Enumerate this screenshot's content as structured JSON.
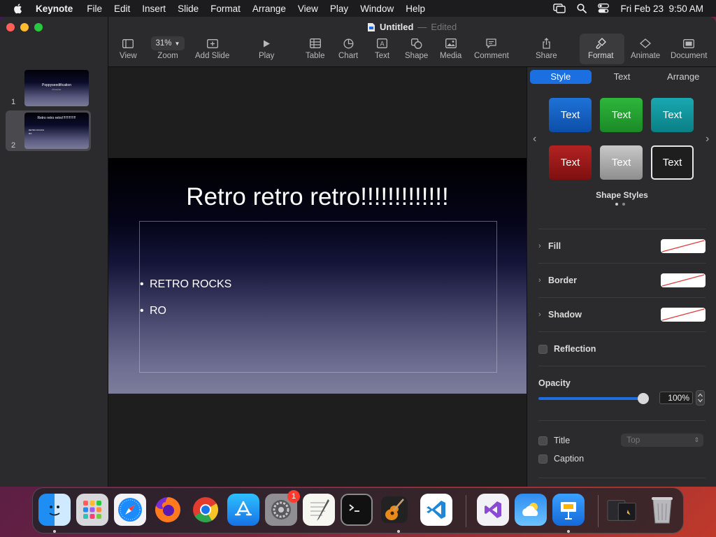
{
  "menubar": {
    "app": "Keynote",
    "items": [
      "File",
      "Edit",
      "Insert",
      "Slide",
      "Format",
      "Arrange",
      "View",
      "Play",
      "Window",
      "Help"
    ],
    "datetime": "Fri Feb 23  9:50 AM"
  },
  "window": {
    "title": "Untitled",
    "dash": "—",
    "status": "Edited"
  },
  "toolbar": {
    "view": "View",
    "zoom_value": "31%",
    "zoom": "Zoom",
    "add_slide": "Add Slide",
    "play": "Play",
    "table": "Table",
    "chart": "Chart",
    "text": "Text",
    "shape": "Shape",
    "media": "Media",
    "comment": "Comment",
    "share": "Share",
    "format": "Format",
    "animate": "Animate",
    "document": "Document"
  },
  "navigator": {
    "slides": [
      {
        "num": "1",
        "title": "Poppyseedification",
        "subtitle": "Presenter"
      },
      {
        "num": "2",
        "title": "Retro retro retro!!!!!!!!!!!!!!",
        "bullets": [
          "RETRO ROCKS",
          "RO"
        ]
      }
    ]
  },
  "slide": {
    "title": "Retro retro retro!!!!!!!!!!!!!",
    "bullets": [
      "RETRO ROCKS",
      "RO"
    ]
  },
  "inspector": {
    "tabs": [
      "Style",
      "Text",
      "Arrange"
    ],
    "swatch_label": "Text",
    "shape_styles": "Shape Styles",
    "fill": "Fill",
    "border": "Border",
    "shadow": "Shadow",
    "reflection": "Reflection",
    "opacity": "Opacity",
    "opacity_value": "100%",
    "opacity_level": 1.0,
    "title": "Title",
    "title_position": "Top",
    "caption": "Caption"
  },
  "colors": {
    "accent": "#1b6fe0",
    "slide_top": "#000000",
    "slide_bottom": "#7c7c9a"
  },
  "dock": {
    "apps": [
      "finder-icon",
      "launchpad-icon",
      "safari-icon",
      "firefox-icon",
      "chrome-icon",
      "app-store-icon",
      "system-settings-icon",
      "textedit-icon",
      "terminal-icon",
      "garageband-icon",
      "vscode-icon",
      "visual-studio-icon",
      "weather-icon",
      "keynote-icon",
      "downloads-icon",
      "trash-icon"
    ],
    "settings_badge": "1"
  }
}
